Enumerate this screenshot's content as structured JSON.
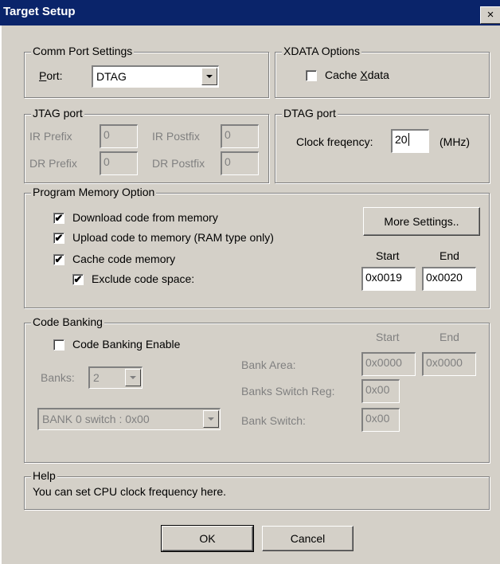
{
  "window": {
    "title": "Target Setup",
    "close_glyph": "×"
  },
  "comm_port": {
    "legend": "Comm Port Settings",
    "port_label": "Port:",
    "port_value": "DTAG"
  },
  "xdata": {
    "legend": "XDATA Options",
    "cache_xdata_label": "Cache Xdata",
    "cache_xdata_checked": false
  },
  "jtag": {
    "legend": "JTAG port",
    "ir_prefix_label": "IR Prefix",
    "ir_prefix_value": "0",
    "ir_postfix_label": "IR Postfix",
    "ir_postfix_value": "0",
    "dr_prefix_label": "DR Prefix",
    "dr_prefix_value": "0",
    "dr_postfix_label": "DR Postfix",
    "dr_postfix_value": "0"
  },
  "dtag": {
    "legend": "DTAG port",
    "clock_label": "Clock freqency:",
    "clock_value": "20",
    "unit": "(MHz)"
  },
  "program_memory": {
    "legend": "Program Memory Option",
    "download_label": "Download code from memory",
    "download_checked": true,
    "upload_label": "Upload code to memory (RAM type only)",
    "upload_checked": true,
    "cache_label": "Cache code memory",
    "cache_checked": true,
    "exclude_label": "Exclude code space:",
    "exclude_checked": true,
    "more_settings_label": "More Settings..",
    "start_label": "Start",
    "end_label": "End",
    "start_value": "0x0019",
    "end_value": "0x0020"
  },
  "code_banking": {
    "legend": "Code Banking",
    "enable_label": "Code Banking Enable",
    "enable_checked": false,
    "banks_label": "Banks:",
    "banks_value": "2",
    "bank_switch_combo_value": "BANK 0 switch : 0x00",
    "start_label": "Start",
    "end_label": "End",
    "bank_area_label": "Bank Area:",
    "bank_area_start": "0x0000",
    "bank_area_end": "0x0000",
    "banks_switch_reg_label": "Banks Switch Reg:",
    "banks_switch_reg_value": "0x00",
    "bank_switch_label": "Bank Switch:",
    "bank_switch_value": "0x00"
  },
  "help": {
    "legend": "Help",
    "text": "You can set CPU clock frequency here."
  },
  "buttons": {
    "ok_label": "OK",
    "cancel_label": "Cancel"
  },
  "check_glyph": "✔",
  "colors": {
    "titlebar": "#0a246a",
    "face": "#d4d0c8",
    "disabled_text": "#808080"
  }
}
